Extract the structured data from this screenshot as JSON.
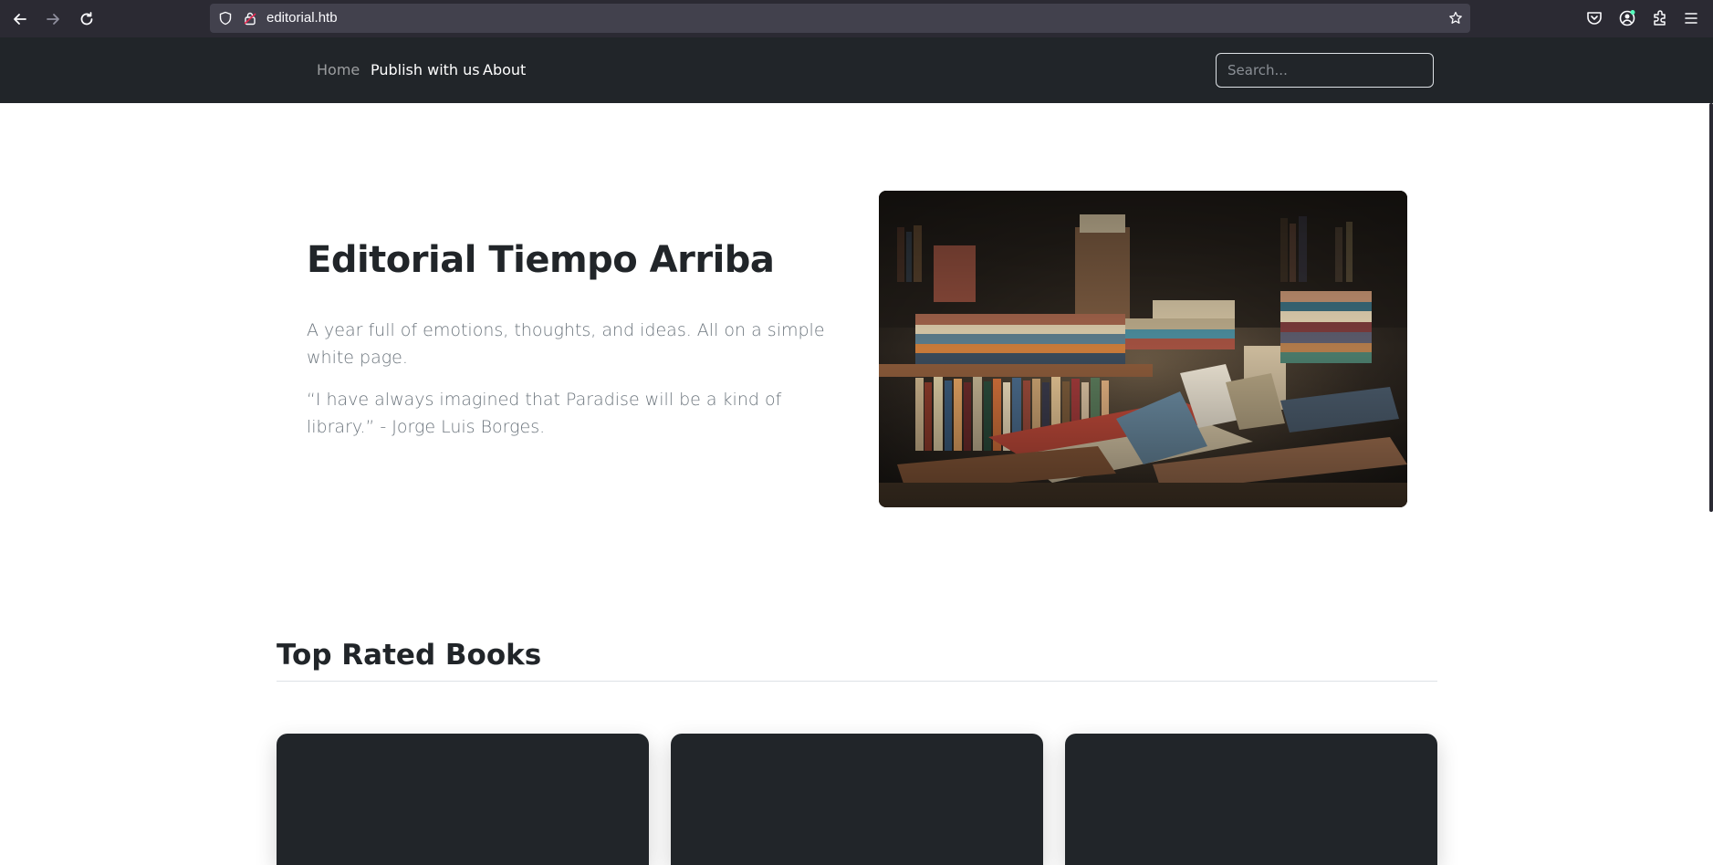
{
  "browser": {
    "url": "editorial.htb"
  },
  "nav": {
    "links": [
      "Home",
      "Publish with us",
      "About"
    ],
    "search_placeholder": "Search..."
  },
  "hero": {
    "title": "Editorial Tiempo Arriba",
    "paragraph1": "A year full of emotions, thoughts, and ideas. All on a simple white page.",
    "paragraph2": "“I have always imagined that Paradise will be a kind of library.” - Jorge Luis Borges."
  },
  "section": {
    "title": "Top Rated Books"
  },
  "colors": {
    "navbar": "#212529",
    "browser_chrome": "#2b2a33",
    "url_bar": "#42414d",
    "card": "#212529"
  },
  "icons": [
    "back-arrow-icon",
    "forward-arrow-icon",
    "reload-icon",
    "shield-icon",
    "lock-icon",
    "bookmark-star-icon",
    "pocket-icon",
    "account-icon",
    "extensions-icon",
    "menu-icon"
  ]
}
